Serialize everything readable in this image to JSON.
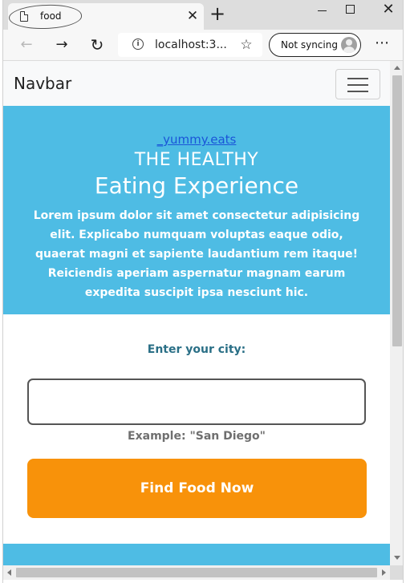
{
  "browser": {
    "tab_title": "food",
    "url": "localhost:3...",
    "sync_label": "Not syncing",
    "icons": {
      "tab": "document-icon",
      "close": "close-icon",
      "new_tab": "plus-icon",
      "back": "arrow-left-icon",
      "forward": "arrow-right-icon",
      "reload": "reload-icon",
      "info": "info-icon",
      "favorites": "star-plus-icon",
      "profile": "avatar-icon",
      "menu": "more-dots-icon"
    }
  },
  "page": {
    "navbar": {
      "brand": "Navbar"
    },
    "hero": {
      "link": "_yummy.eats",
      "line1": "THE HEALTHY",
      "line2": "Eating Experience",
      "text": "Lorem ipsum dolor sit amet consectetur adipisicing elit. Explicabo numquam voluptas eaque odio, quaerat magni et sapiente laudantium rem itaque! Reiciendis aperiam aspernatur magnam earum expedita suscipit ipsa nesciunt hic."
    },
    "search": {
      "label": "Enter your city:",
      "value": "",
      "hint": "Example: \"San Diego\"",
      "button": "Find Food Now"
    }
  },
  "colors": {
    "hero_bg": "#4ebce4",
    "button_bg": "#f8920a",
    "label_color": "#2a6f86",
    "link_color": "#1a55d8"
  }
}
